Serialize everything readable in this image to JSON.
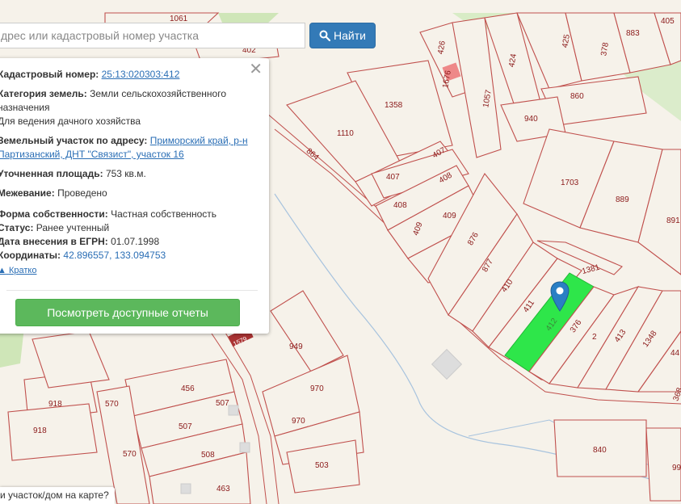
{
  "search": {
    "placeholder": "дрес или кадастровый номер участка",
    "button_label": "Найти",
    "button_icon": "search-icon"
  },
  "popup": {
    "cadastral_label": "Кадастровый номер:",
    "cadastral_value": "25:13:020303:412",
    "category_label": "Категория земель:",
    "category_value": "Земли сельскохозяйственного назначения",
    "usage": "Для ведения дачного хозяйства",
    "address_label": "Земельный участок по адресу:",
    "address_line1": "Приморский край, р-н",
    "address_line2": "Партизанский, ДНТ \"Связист\", участок 16",
    "area_label": "Уточненная площадь:",
    "area_value": "753 кв.м.",
    "survey_label": "Межевание:",
    "survey_value": "Проведено",
    "ownership_label": "Форма собственности:",
    "ownership_value": "Частная собственность",
    "status_label": "Статус:",
    "status_value": "Ранее учтенный",
    "egrn_label": "Дата внесения в ЕГРН:",
    "egrn_value": "01.07.1998",
    "coords_label": "Координаты:",
    "coords_value": "42.896557, 133.094753",
    "brief_label": "Кратко",
    "report_button": "Посмотреть доступные отчеты",
    "close_icon": "close-icon"
  },
  "bottom_hint": "и участок/дом на карте?",
  "map": {
    "selected_color": "#2ee64a",
    "parcel_stroke": "#c0504d",
    "background": "#f6f2ea",
    "labels": {
      "p1061": "1061",
      "p402": "402",
      "p426": "426",
      "p1676": "1676",
      "p1057": "1057",
      "p424": "424",
      "p425": "425",
      "p378": "378",
      "p883": "883",
      "p405": "405",
      "p860": "860",
      "p940": "940",
      "p1358": "1358",
      "p1110": "1110",
      "p864": "864",
      "p407a": "407",
      "p407b": "407",
      "p408a": "408",
      "p408b": "408",
      "p409a": "409",
      "p409b": "409",
      "p876": "876",
      "p877": "877",
      "p410": "410",
      "p411": "411",
      "p412": "412",
      "p376": "376",
      "p2": "2",
      "p413": "413",
      "p1348": "1348",
      "p44": "44",
      "p368": "368",
      "p1381": "1381",
      "p1703": "1703",
      "p889": "889",
      "p891": "891",
      "p949": "949",
      "p970a": "970",
      "p970b": "970",
      "p456": "456",
      "p507a": "507",
      "p507b": "507",
      "p570a": "570",
      "p570b": "570",
      "p918a": "918",
      "p918b": "918",
      "p508": "508",
      "p503": "503",
      "p463": "463",
      "p840": "840",
      "p99": "99",
      "p1579": "1579"
    }
  }
}
